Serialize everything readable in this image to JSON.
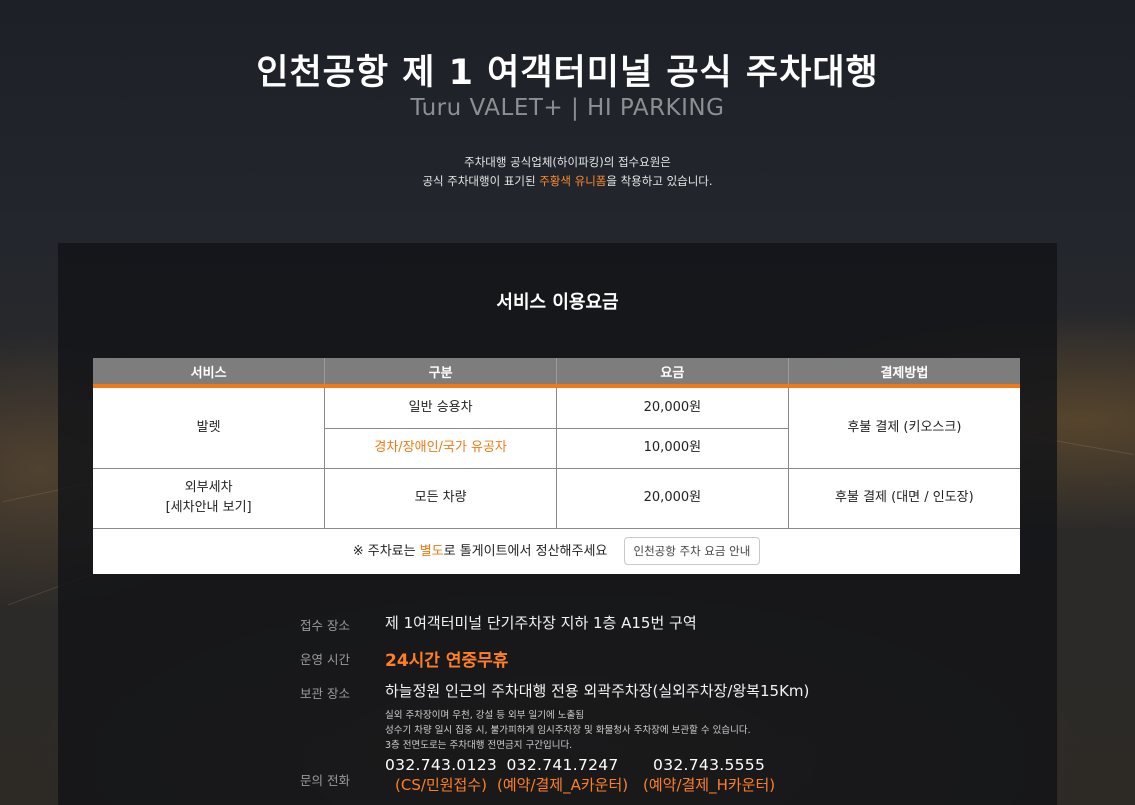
{
  "hero": {
    "title": "인천공항 제 1 여객터미널 공식 주차대행",
    "subtitle": "Turu VALET+ | HI PARKING"
  },
  "notice": {
    "line1": "주차대행 공식업체(하이파킹)의 접수요원은",
    "line2_prefix": "공식 주차대행이 표기된 ",
    "line2_highlight": "주황색 유니폼",
    "line2_suffix": "을 착용하고 있습니다."
  },
  "pricing": {
    "title": "서비스 이용요금",
    "headers": [
      "서비스",
      "구분",
      "요금",
      "결제방법"
    ],
    "valet": {
      "service": "발렛",
      "rows": [
        {
          "category": "일반 승용차",
          "fee": "20,000원"
        },
        {
          "category": "경차/장애인/국가 유공자",
          "fee": "10,000원"
        }
      ],
      "payment": "후불 결제 (키오스크)"
    },
    "wash": {
      "service_line1": "외부세차",
      "service_line2": "[세차안내 보기]",
      "category": "모든 차량",
      "fee": "20,000원",
      "payment": "후불 결제 (대면 / 인도장)"
    },
    "note_prefix": "※ 주차료는 ",
    "note_highlight": "별도",
    "note_suffix": "로 톨게이트에서 정산해주세요",
    "fee_button": "인천공항 주차 요금 안내"
  },
  "info": {
    "reception_label": "접수 장소",
    "reception_value": "제 1여객터미널 단기주차장 지하 1층 A15번 구역",
    "hours_label": "운영 시간",
    "hours_value": "24시간 연중무휴",
    "storage_label": "보관 장소",
    "storage_value": "하늘정원 인근의 주차대행 전용 외곽주차장(실외주차장/왕복15Km)",
    "storage_notes": [
      "실외 주차장이며 우천, 강설 등 외부 일기에 노출됨",
      "성수기 차량 일시 집중 시, 불가피하게 임시주차장 및 화물청사 주차장에 보관할 수 있습니다.",
      "3층 전면도로는 주차대행 전면금지 구간입니다."
    ],
    "contact_label": "문의 전화",
    "phones": [
      {
        "number": "032.743.0123",
        "desc": "(CS/민원접수)"
      },
      {
        "number": "032.741.7247",
        "desc": "(예약/결제_A카운터)"
      },
      {
        "number": "032.743.5555",
        "desc": "(예약/결제_H카운터)"
      }
    ]
  }
}
